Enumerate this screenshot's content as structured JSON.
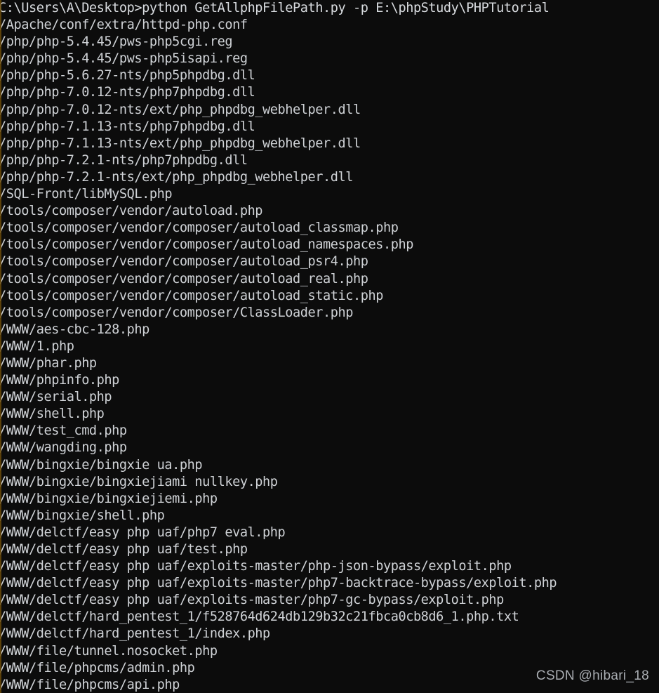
{
  "window": {
    "title": "Command Prompt",
    "background_color": "#0c0c0c",
    "text_color": "#cfd2d6",
    "accent_edge_color": "#6b4a08"
  },
  "console": {
    "prompt": "C:\\Users\\A\\Desktop>",
    "command": "python GetAllphpFilePath.py -p E:\\phpStudy\\PHPTutorial",
    "lines": [
      "C:\\Users\\A\\Desktop>python GetAllphpFilePath.py -p E:\\phpStudy\\PHPTutorial",
      "/Apache/conf/extra/httpd-php.conf",
      "/php/php-5.4.45/pws-php5cgi.reg",
      "/php/php-5.4.45/pws-php5isapi.reg",
      "/php/php-5.6.27-nts/php5phpdbg.dll",
      "/php/php-7.0.12-nts/php7phpdbg.dll",
      "/php/php-7.0.12-nts/ext/php_phpdbg_webhelper.dll",
      "/php/php-7.1.13-nts/php7phpdbg.dll",
      "/php/php-7.1.13-nts/ext/php_phpdbg_webhelper.dll",
      "/php/php-7.2.1-nts/php7phpdbg.dll",
      "/php/php-7.2.1-nts/ext/php_phpdbg_webhelper.dll",
      "/SQL-Front/libMySQL.php",
      "/tools/composer/vendor/autoload.php",
      "/tools/composer/vendor/composer/autoload_classmap.php",
      "/tools/composer/vendor/composer/autoload_namespaces.php",
      "/tools/composer/vendor/composer/autoload_psr4.php",
      "/tools/composer/vendor/composer/autoload_real.php",
      "/tools/composer/vendor/composer/autoload_static.php",
      "/tools/composer/vendor/composer/ClassLoader.php",
      "/WWW/aes-cbc-128.php",
      "/WWW/1.php",
      "/WWW/phar.php",
      "/WWW/phpinfo.php",
      "/WWW/serial.php",
      "/WWW/shell.php",
      "/WWW/test_cmd.php",
      "/WWW/wangding.php",
      "/WWW/bingxie/bingxie ua.php",
      "/WWW/bingxie/bingxiejiami nullkey.php",
      "/WWW/bingxie/bingxiejiemi.php",
      "/WWW/bingxie/shell.php",
      "/WWW/delctf/easy php uaf/php7 eval.php",
      "/WWW/delctf/easy php uaf/test.php",
      "/WWW/delctf/easy php uaf/exploits-master/php-json-bypass/exploit.php",
      "/WWW/delctf/easy php uaf/exploits-master/php7-backtrace-bypass/exploit.php",
      "/WWW/delctf/easy php uaf/exploits-master/php7-gc-bypass/exploit.php",
      "/WWW/delctf/hard_pentest_1/f528764d624db129b32c21fbca0cb8d6_1.php.txt",
      "/WWW/delctf/hard_pentest_1/index.php",
      "/WWW/file/tunnel.nosocket.php",
      "/WWW/file/phpcms/admin.php",
      "/WWW/file/phpcms/api.php"
    ]
  },
  "watermark": {
    "text": "CSDN @hibari_18"
  }
}
